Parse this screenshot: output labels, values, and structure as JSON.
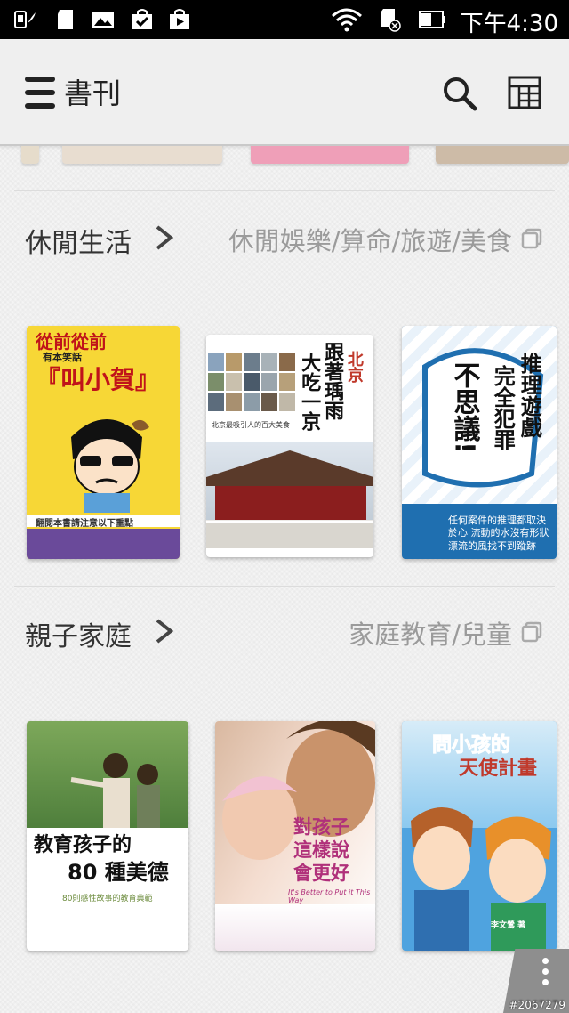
{
  "status_bar": {
    "time": "下午4:30",
    "icons": [
      "sim-card-icon",
      "sd-card-icon",
      "image-icon",
      "shopping-bag-icon",
      "play-store-icon",
      "wifi-icon",
      "sd-card-error-icon",
      "battery-icon"
    ]
  },
  "app_bar": {
    "title": "書刊",
    "icons": [
      "menu-icon",
      "search-icon",
      "grid-view-icon"
    ]
  },
  "sections": [
    {
      "title": "休閒生活",
      "subcategories": "休閒娛樂/算命/旅遊/美食",
      "books": [
        {
          "title_lines": [
            "從前從前",
            "有本笑話",
            "『叫小賀』"
          ],
          "small_text": "翻閱本書請注意以下重點",
          "color": "#f5d631"
        },
        {
          "title_lines": [
            "北京",
            "跟著瑀雨",
            "大吃一京"
          ],
          "small_text": "北京最吸引人的百大美食",
          "color": "#6c8fb5"
        },
        {
          "title_lines": [
            "推理遊戲",
            "完全犯罪",
            "不思議!"
          ],
          "small_text": "任何案件的推理都取決於心 流動的水沒有形狀 漂流的風找不到蹤跡",
          "color": "#1f6fb0"
        }
      ]
    },
    {
      "title": "親子家庭",
      "subcategories": "家庭教育/兒童",
      "books": [
        {
          "title_lines": [
            "教育孩子的",
            "80 種美德"
          ],
          "small_text": "80則感性故事的教育典範",
          "color": "#5f8f4e"
        },
        {
          "title_lines": [
            "對孩子",
            "這樣說",
            "會更好"
          ],
          "small_text": "It's Better to Put it This Way",
          "color": "#c76a4a"
        },
        {
          "title_lines": [
            "問小孩的",
            "天使計畫"
          ],
          "small_text": "李文鶯 著",
          "color": "#3a8dc9"
        }
      ]
    }
  ],
  "overflow_menu": {
    "icon": "more-vertical-icon"
  },
  "watermark": "#2067279"
}
